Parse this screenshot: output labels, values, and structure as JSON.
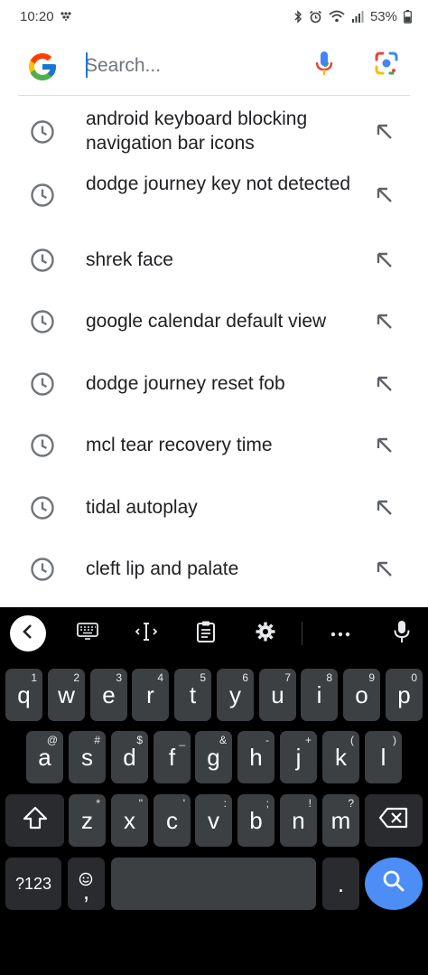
{
  "status_bar": {
    "time": "10:20",
    "battery": "53%"
  },
  "search": {
    "placeholder": "Search...",
    "value": ""
  },
  "suggestions": [
    {
      "text": "android keyboard blocking navigation bar icons"
    },
    {
      "text": "dodge journey key not detected"
    },
    {
      "text": "shrek face"
    },
    {
      "text": "google calendar default view"
    },
    {
      "text": "dodge journey reset fob"
    },
    {
      "text": "mcl tear recovery time"
    },
    {
      "text": "tidal autoplay"
    },
    {
      "text": "cleft lip and palate"
    }
  ],
  "keyboard": {
    "row1": [
      {
        "label": "q",
        "hint": "1"
      },
      {
        "label": "w",
        "hint": "2"
      },
      {
        "label": "e",
        "hint": "3"
      },
      {
        "label": "r",
        "hint": "4"
      },
      {
        "label": "t",
        "hint": "5"
      },
      {
        "label": "y",
        "hint": "6"
      },
      {
        "label": "u",
        "hint": "7"
      },
      {
        "label": "i",
        "hint": "8"
      },
      {
        "label": "o",
        "hint": "9"
      },
      {
        "label": "p",
        "hint": "0"
      }
    ],
    "row2": [
      {
        "label": "a",
        "hint": "@"
      },
      {
        "label": "s",
        "hint": "#"
      },
      {
        "label": "d",
        "hint": "$"
      },
      {
        "label": "f",
        "hint": "_"
      },
      {
        "label": "g",
        "hint": "&"
      },
      {
        "label": "h",
        "hint": "-"
      },
      {
        "label": "j",
        "hint": "+"
      },
      {
        "label": "k",
        "hint": "("
      },
      {
        "label": "l",
        "hint": ")"
      }
    ],
    "row3": [
      {
        "label": "z",
        "hint": "*"
      },
      {
        "label": "x",
        "hint": "\""
      },
      {
        "label": "c",
        "hint": "'"
      },
      {
        "label": "v",
        "hint": ":"
      },
      {
        "label": "b",
        "hint": ";"
      },
      {
        "label": "n",
        "hint": "!"
      },
      {
        "label": "m",
        "hint": "?"
      }
    ],
    "symbols_label": "?123",
    "comma_label": ",",
    "period_label": "."
  },
  "colors": {
    "accent": "#1a73e8",
    "search_key": "#4c8df6",
    "key_bg": "#3c4043",
    "keyboard_bg": "#000000"
  }
}
